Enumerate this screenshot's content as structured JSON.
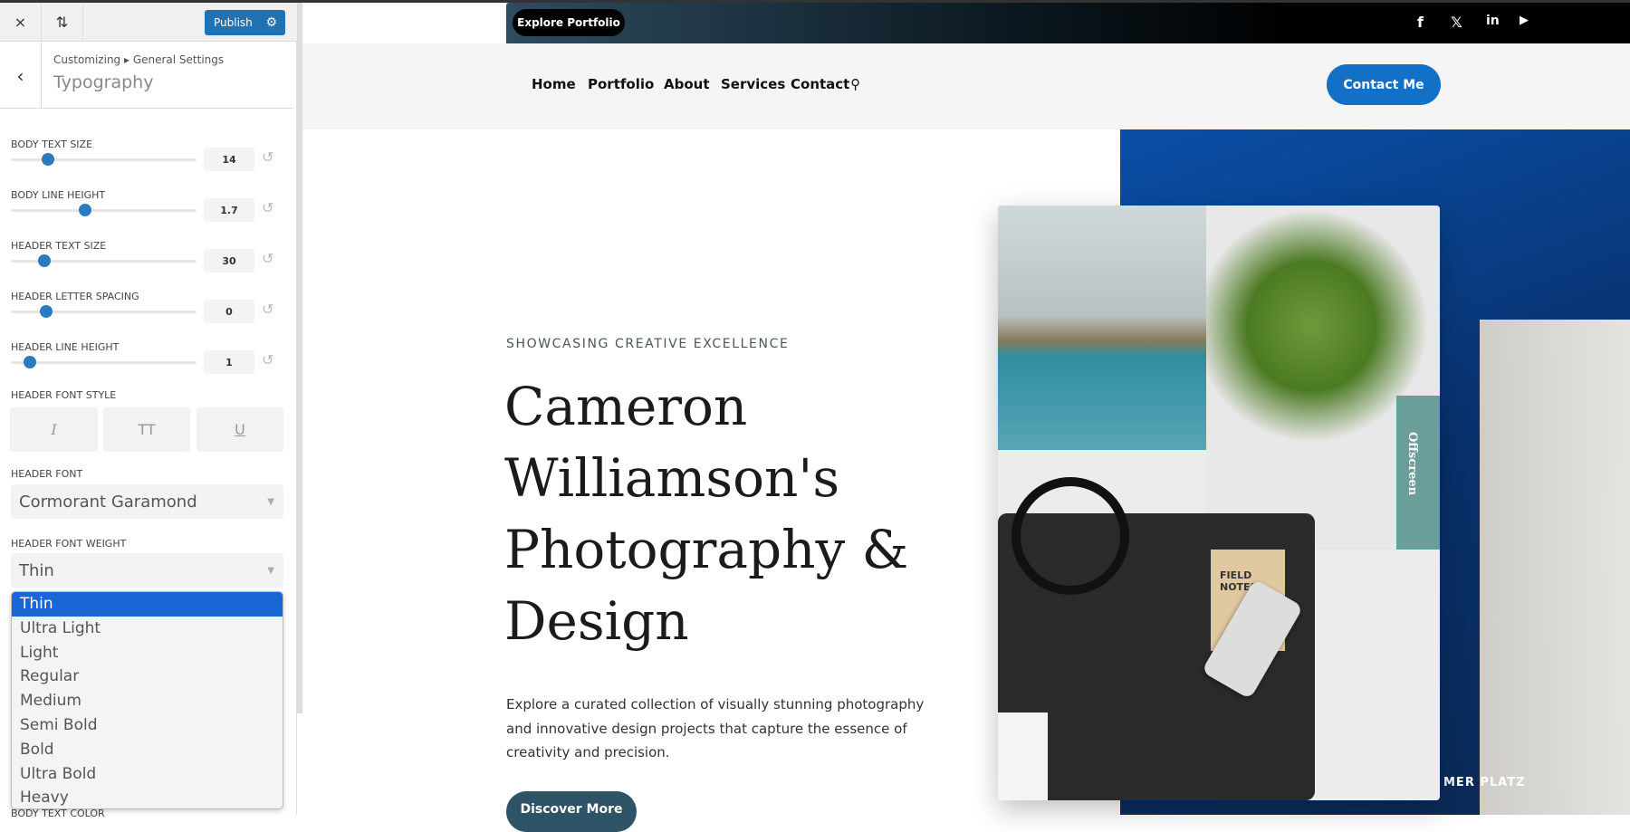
{
  "panel": {
    "close_icon": "×",
    "sort_icon": "⇅",
    "publish_label": "Publish",
    "breadcrumb": "Customizing ▸ General Settings",
    "title": "Typography",
    "sliders": [
      {
        "label": "BODY TEXT SIZE",
        "value": "14",
        "fill": 0.2
      },
      {
        "label": "BODY LINE HEIGHT",
        "value": "1.7",
        "fill": 0.4
      },
      {
        "label": "HEADER TEXT SIZE",
        "value": "30",
        "fill": 0.18
      },
      {
        "label": "HEADER LETTER SPACING",
        "value": "0",
        "fill": 0.19
      },
      {
        "label": "HEADER LINE HEIGHT",
        "value": "1",
        "fill": 0.1
      }
    ],
    "font_style_label": "HEADER FONT STYLE",
    "font_style_buttons": [
      "I",
      "TT",
      "U"
    ],
    "font_label": "HEADER FONT",
    "font_value": "Cormorant Garamond",
    "weight_label": "HEADER FONT WEIGHT",
    "weight_value": "Thin",
    "weight_options": [
      "Thin",
      "Ultra Light",
      "Light",
      "Regular",
      "Medium",
      "Semi Bold",
      "Bold",
      "Ultra Bold",
      "Heavy"
    ],
    "next_label": "BODY TEXT COLOR",
    "accent": "#2271b1"
  },
  "site": {
    "explore": "Explore Portfolio",
    "socials": [
      "facebook-icon",
      "x-icon",
      "linkedin-icon",
      "youtube-icon"
    ],
    "nav": [
      "Home",
      "Portfolio",
      "About",
      "Services",
      "Contact"
    ],
    "contact_btn": "Contact Me",
    "eyebrow": "SHOWCASING CREATIVE EXCELLENCE",
    "heading": "Cameron Williamson's Photography & Design",
    "paragraph": "Explore a curated collection of visually stunning photography and innovative design projects that capture the essence of creativity and precision.",
    "cta": "Discover More",
    "notebook": "FIELD NOTES",
    "book": "Offscreen",
    "sign": "MER PLATZ",
    "brand": "#1270c6"
  }
}
